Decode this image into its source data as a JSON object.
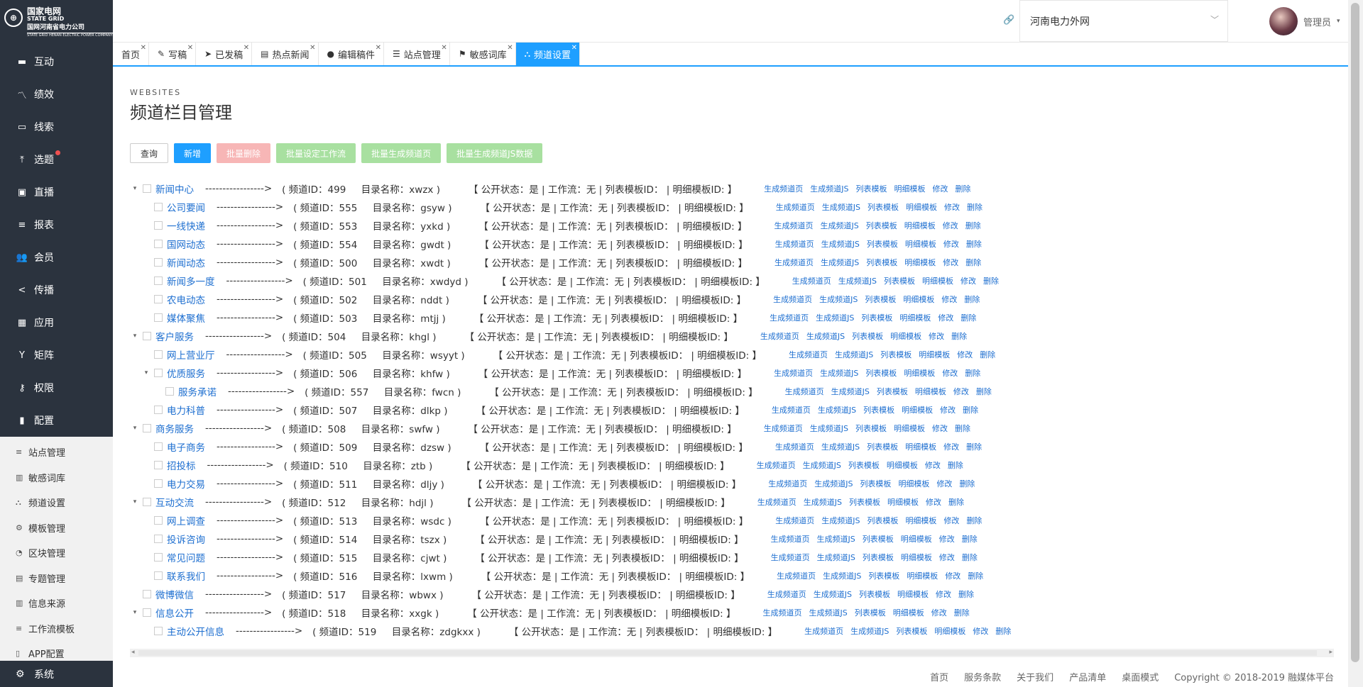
{
  "logo": {
    "line1": "国家电网",
    "line2": "STATE GRID",
    "line3": "国网河南省电力公司",
    "line4": "STATE GRID HENAN ELECTRIC POWER COMPANY"
  },
  "sidebar": {
    "items": [
      {
        "label": "互动",
        "icon": "chat-icon"
      },
      {
        "label": "绩效",
        "icon": "chart-line-icon"
      },
      {
        "label": "线索",
        "icon": "comment-icon"
      },
      {
        "label": "选题",
        "icon": "pin-icon",
        "badge": true
      },
      {
        "label": "直播",
        "icon": "video-icon"
      },
      {
        "label": "报表",
        "icon": "list-icon"
      },
      {
        "label": "会员",
        "icon": "users-icon"
      },
      {
        "label": "传播",
        "icon": "share-icon"
      },
      {
        "label": "应用",
        "icon": "briefcase-icon"
      },
      {
        "label": "矩阵",
        "icon": "fork-icon"
      },
      {
        "label": "权限",
        "icon": "key-icon"
      },
      {
        "label": "配置",
        "icon": "file-icon"
      }
    ],
    "sub_items": [
      {
        "label": "站点管理",
        "icon": "list-icon"
      },
      {
        "label": "敏感词库",
        "icon": "book-icon"
      },
      {
        "label": "频道设置",
        "icon": "sitemap-icon"
      },
      {
        "label": "模板管理",
        "icon": "gear-icon"
      },
      {
        "label": "区块管理",
        "icon": "rss-icon"
      },
      {
        "label": "专题管理",
        "icon": "image-icon"
      },
      {
        "label": "信息来源",
        "icon": "book-icon"
      },
      {
        "label": "工作流模板",
        "icon": "list-icon"
      },
      {
        "label": "APP配置",
        "icon": "mobile-icon"
      }
    ],
    "bottom": {
      "label": "系统",
      "icon": "gear-icon"
    }
  },
  "header": {
    "site": "河南电力外网",
    "user": "管理员"
  },
  "tabs": [
    {
      "label": "首页",
      "icon": ""
    },
    {
      "label": "写稿",
      "icon": "✎"
    },
    {
      "label": "已发稿",
      "icon": "➤"
    },
    {
      "label": "热点新闻",
      "icon": "▤"
    },
    {
      "label": "编辑稿件",
      "icon": "●"
    },
    {
      "label": "站点管理",
      "icon": "☰"
    },
    {
      "label": "敏感词库",
      "icon": "⚑"
    },
    {
      "label": "频道设置",
      "icon": "⛬",
      "active": true
    }
  ],
  "page": {
    "pre_title": "WEBSITES",
    "title": "频道栏目管理"
  },
  "toolbar": {
    "query": "查询",
    "add": "新增",
    "batch_delete": "批量删除",
    "batch_workflow": "批量设定工作流",
    "batch_generate": "批量生成频道页",
    "batch_js": "批量生成频道JS数据"
  },
  "tree": {
    "arrow": "----------------->",
    "status": "【 公开状态：是 | 工作流：无 | 列表模板ID： | 明细模板ID: 】",
    "ops": [
      "生成频道页",
      "生成频道JS",
      "列表模板",
      "明细模板",
      "修改",
      "删除"
    ],
    "rows": [
      {
        "level": 0,
        "caret": "▾",
        "name": "新闻中心",
        "id": "( 频道ID：499",
        "dir": "目录名称：xwzx )"
      },
      {
        "level": 1,
        "caret": "",
        "name": "公司要闻",
        "id": "( 频道ID：555",
        "dir": "目录名称：gsyw )"
      },
      {
        "level": 1,
        "caret": "",
        "name": "一线快递",
        "id": "( 频道ID：553",
        "dir": "目录名称：yxkd )"
      },
      {
        "level": 1,
        "caret": "",
        "name": "国网动态",
        "id": "( 频道ID：554",
        "dir": "目录名称：gwdt )"
      },
      {
        "level": 1,
        "caret": "",
        "name": "新闻动态",
        "id": "( 频道ID：500",
        "dir": "目录名称：xwdt )"
      },
      {
        "level": 1,
        "caret": "",
        "name": "新闻多一度",
        "id": "( 频道ID：501",
        "dir": "目录名称：xwdyd )"
      },
      {
        "level": 1,
        "caret": "",
        "name": "农电动态",
        "id": "( 频道ID：502",
        "dir": "目录名称：nddt )"
      },
      {
        "level": 1,
        "caret": "",
        "name": "媒体聚焦",
        "id": "( 频道ID：503",
        "dir": "目录名称：mtjj )"
      },
      {
        "level": 0,
        "caret": "▾",
        "name": "客户服务",
        "id": "( 频道ID：504",
        "dir": "目录名称：khgl )"
      },
      {
        "level": 1,
        "caret": "",
        "name": "网上营业厅",
        "id": "( 频道ID：505",
        "dir": "目录名称：wsyyt )"
      },
      {
        "level": 1,
        "caret": "▾",
        "name": "优质服务",
        "id": "( 频道ID：506",
        "dir": "目录名称：khfw )"
      },
      {
        "level": 2,
        "caret": "",
        "name": "服务承诺",
        "id": "( 频道ID：557",
        "dir": "目录名称：fwcn )"
      },
      {
        "level": 1,
        "caret": "",
        "name": "电力科普",
        "id": "( 频道ID：507",
        "dir": "目录名称：dlkp )"
      },
      {
        "level": 0,
        "caret": "▾",
        "name": "商务服务",
        "id": "( 频道ID：508",
        "dir": "目录名称：swfw )"
      },
      {
        "level": 1,
        "caret": "",
        "name": "电子商务",
        "id": "( 频道ID：509",
        "dir": "目录名称：dzsw )"
      },
      {
        "level": 1,
        "caret": "",
        "name": "招投标",
        "id": "( 频道ID：510",
        "dir": "目录名称：ztb )"
      },
      {
        "level": 1,
        "caret": "",
        "name": "电力交易",
        "id": "( 频道ID：511",
        "dir": "目录名称：dljy )"
      },
      {
        "level": 0,
        "caret": "▾",
        "name": "互动交流",
        "id": "( 频道ID：512",
        "dir": "目录名称：hdjl )"
      },
      {
        "level": 1,
        "caret": "",
        "name": "网上调查",
        "id": "( 频道ID：513",
        "dir": "目录名称：wsdc )"
      },
      {
        "level": 1,
        "caret": "",
        "name": "投诉咨询",
        "id": "( 频道ID：514",
        "dir": "目录名称：tszx )"
      },
      {
        "level": 1,
        "caret": "",
        "name": "常见问题",
        "id": "( 频道ID：515",
        "dir": "目录名称：cjwt )"
      },
      {
        "level": 1,
        "caret": "",
        "name": "联系我们",
        "id": "( 频道ID：516",
        "dir": "目录名称：lxwm )"
      },
      {
        "level": 0,
        "caret": "",
        "name": "微博微信",
        "id": "( 频道ID：517",
        "dir": "目录名称：wbwx )"
      },
      {
        "level": 0,
        "caret": "▾",
        "name": "信息公开",
        "id": "( 频道ID：518",
        "dir": "目录名称：xxgk )"
      },
      {
        "level": 1,
        "caret": "",
        "name": "主动公开信息",
        "id": "( 频道ID：519",
        "dir": "目录名称：zdgkxx )"
      }
    ]
  },
  "footer": {
    "links": [
      "首页",
      "服务条款",
      "关于我们",
      "产品清单",
      "桌面模式"
    ],
    "copyright": "Copyright © 2018-2019 融媒体平台"
  }
}
